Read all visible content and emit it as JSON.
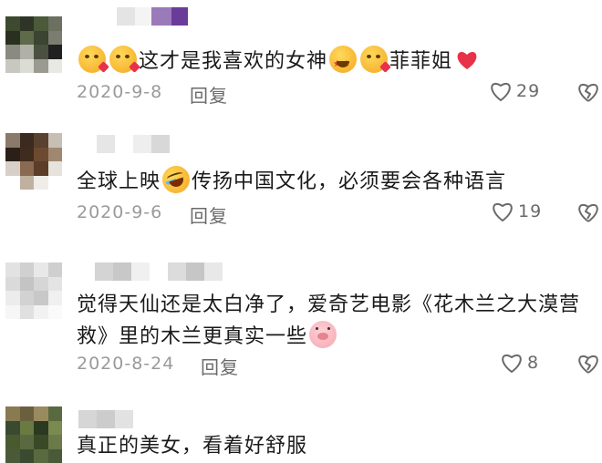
{
  "comments": [
    {
      "text_parts": [
        "这才是我喜欢的女神",
        "菲菲姐"
      ],
      "date": "2020-9-8",
      "reply": "回复",
      "likes": "29"
    },
    {
      "text_parts": [
        "全球上映",
        "传扬中国文化，必须要会各种语言"
      ],
      "date": "2020-9-6",
      "reply": "回复",
      "likes": "19"
    },
    {
      "text_parts": [
        "觉得天仙还是太白净了，爱奇艺电影《花木兰之大漠营救》里的木兰更真实一些"
      ],
      "date": "2020-8-24",
      "reply": "回复",
      "likes": "8"
    },
    {
      "text_parts": [
        "真正的美女，看着好舒服"
      ]
    }
  ],
  "icons": {
    "like": "heart-outline-icon",
    "dislike": "broken-heart-icon",
    "red_heart": "red-heart-emoji",
    "emojis": [
      "kissing-face-emoji",
      "star-struck-emoji",
      "rolling-laughing-emoji",
      "pig-face-emoji"
    ]
  },
  "colors": {
    "text": "#1a1a1a",
    "meta": "#9a9a9a",
    "heart": "#e8324a"
  }
}
